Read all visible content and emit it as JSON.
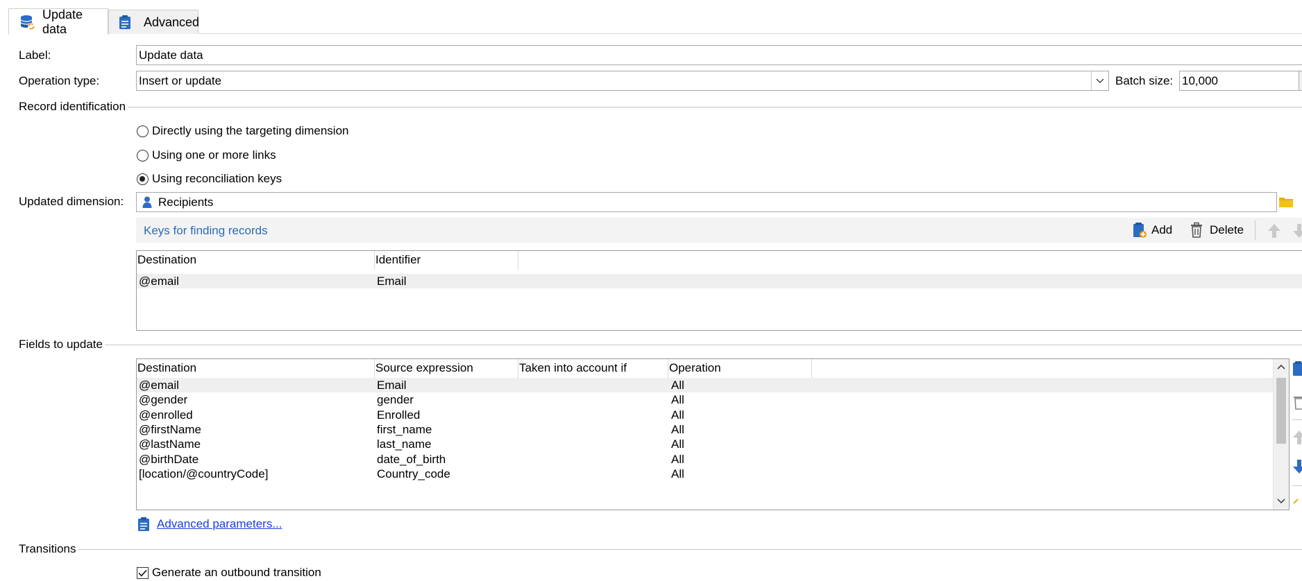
{
  "tabs": [
    {
      "label": "Update data",
      "icon": "database-sync-icon",
      "active": true
    },
    {
      "label": "Advanced",
      "icon": "clipboard-icon",
      "active": false
    }
  ],
  "form": {
    "label_caption": "Label:",
    "label_value": "Update data",
    "operation_caption": "Operation type:",
    "operation_value": "Insert or update",
    "batch_caption": "Batch size:",
    "batch_value": "10,000"
  },
  "record_identification": {
    "title": "Record identification",
    "options": [
      {
        "label": "Directly using the targeting dimension",
        "checked": false
      },
      {
        "label": "Using one or more links",
        "checked": false
      },
      {
        "label": "Using reconciliation keys",
        "checked": true
      }
    ]
  },
  "updated_dimension": {
    "caption": "Updated dimension:",
    "value": "Recipients",
    "icon": "person-icon"
  },
  "keys": {
    "title": "Keys for finding records",
    "add_label": "Add",
    "delete_label": "Delete",
    "columns": [
      "Destination",
      "Identifier"
    ],
    "rows": [
      [
        "@email",
        "Email"
      ]
    ]
  },
  "fields": {
    "title": "Fields to update",
    "columns": [
      "Destination",
      "Source expression",
      "Taken into account if",
      "Operation"
    ],
    "rows": [
      [
        "@email",
        "Email",
        "",
        "All"
      ],
      [
        "@gender",
        "gender",
        "",
        "All"
      ],
      [
        "@enrolled",
        "Enrolled",
        "",
        "All"
      ],
      [
        "@firstName",
        "first_name",
        "",
        "All"
      ],
      [
        "@lastName",
        "last_name",
        "",
        "All"
      ],
      [
        "@birthDate",
        "date_of_birth",
        "",
        "All"
      ],
      [
        "[location/@countryCode]",
        "Country_code",
        "",
        "All"
      ]
    ],
    "advanced_link": "Advanced parameters..."
  },
  "transitions": {
    "title": "Transitions",
    "generate_label": "Generate an outbound transition",
    "generate_checked": true
  },
  "colors": {
    "accent_blue": "#2b6cc4",
    "link_blue": "#1a3fd6",
    "folder_yellow": "#e8b200",
    "selected_row": "#efefef"
  }
}
